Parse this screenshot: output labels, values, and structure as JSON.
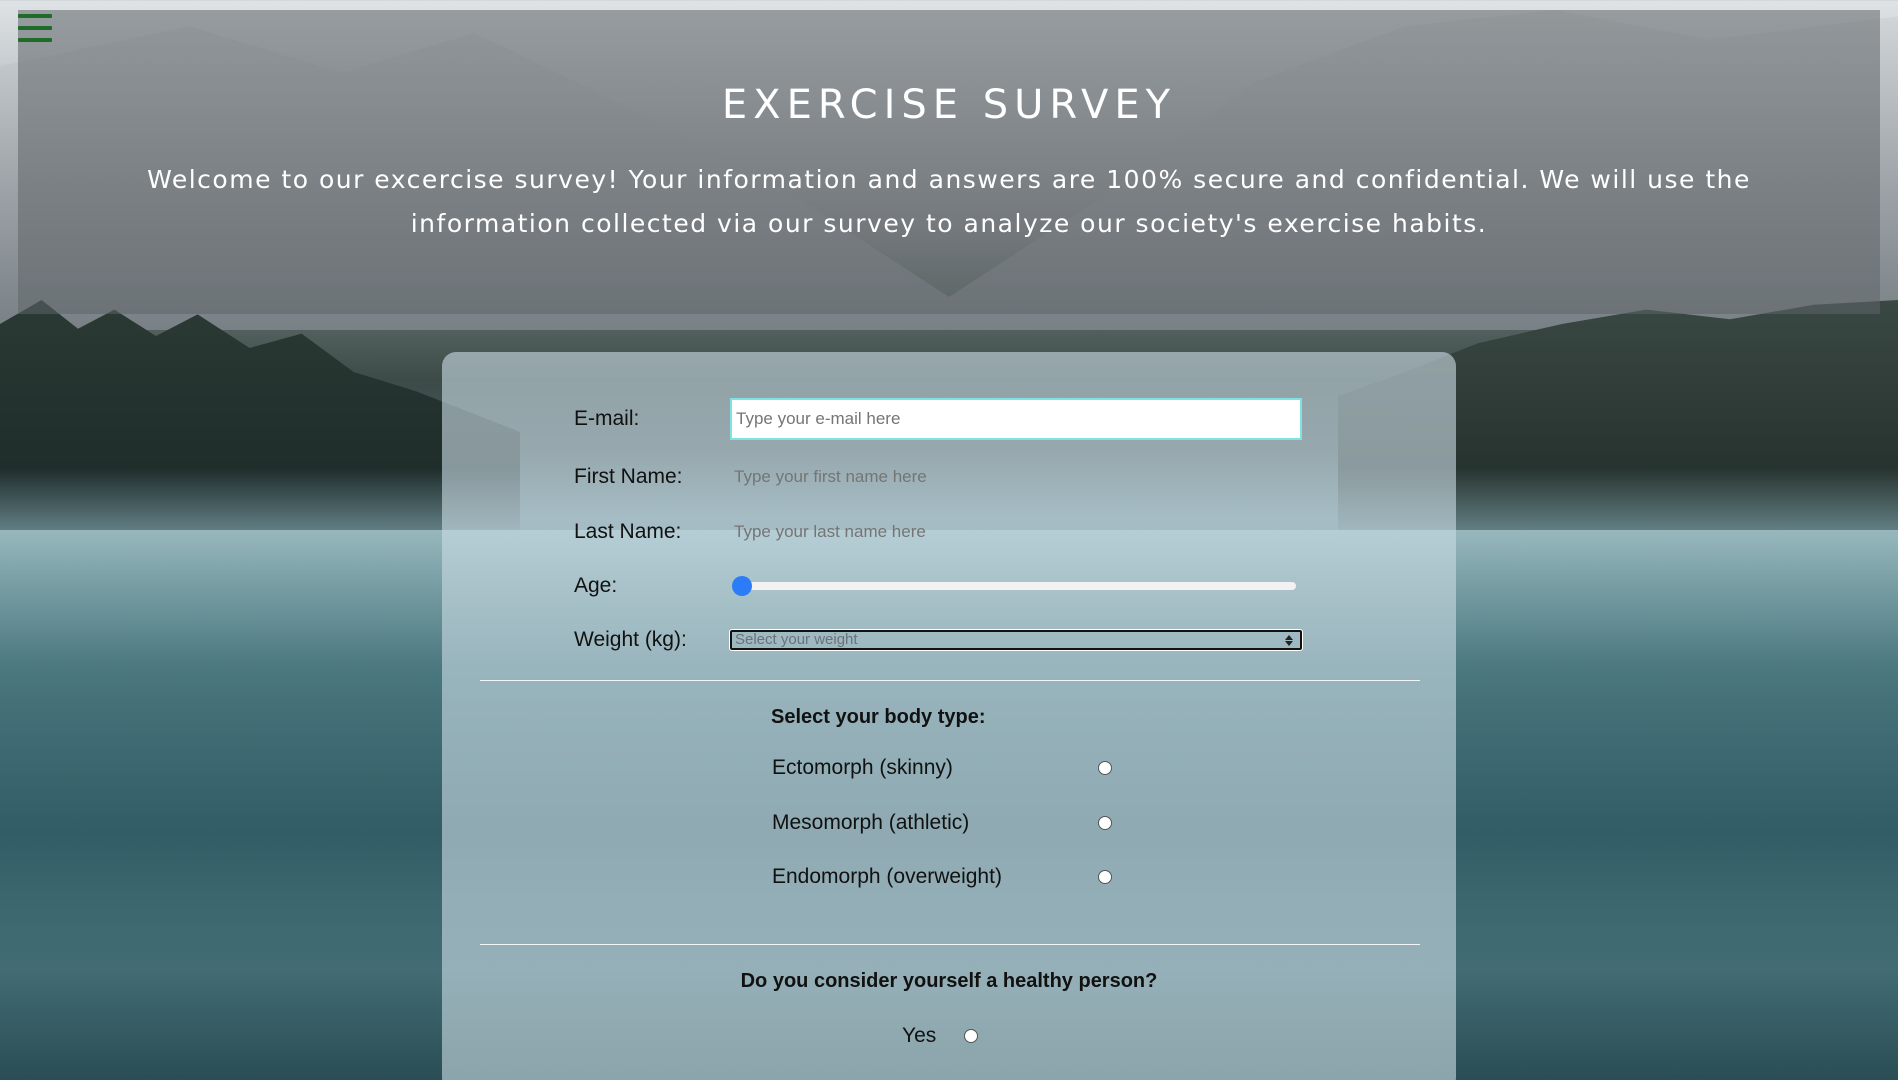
{
  "header": {
    "title": "EXERCISE SURVEY",
    "description": "Welcome to our excercise survey! Your information and answers are 100% secure and confidential. We will use the information collected via our survey to analyze our society's exercise habits."
  },
  "menu": {
    "icon": "hamburger-menu-icon",
    "color": "#1e6b2a"
  },
  "form": {
    "email": {
      "label": "E-mail:",
      "placeholder": "Type your e-mail here"
    },
    "first_name": {
      "label": "First Name:",
      "placeholder": "Type your first name here"
    },
    "last_name": {
      "label": "Last Name:",
      "placeholder": "Type your last name here"
    },
    "age": {
      "label": "Age:",
      "value_fraction": 0
    },
    "weight": {
      "label": "Weight (kg):",
      "placeholder": "Select your weight"
    },
    "body_type": {
      "title": "Select your body type:",
      "options": [
        {
          "label": "Ectomorph (skinny)"
        },
        {
          "label": "Mesomorph (athletic)"
        },
        {
          "label": "Endomorph (overweight)"
        }
      ]
    },
    "healthy": {
      "title": "Do you consider yourself a healthy person?",
      "options": [
        {
          "label": "Yes"
        }
      ]
    }
  },
  "colors": {
    "accent": "#2b7cf6",
    "email_border": "#7fe3e3"
  }
}
